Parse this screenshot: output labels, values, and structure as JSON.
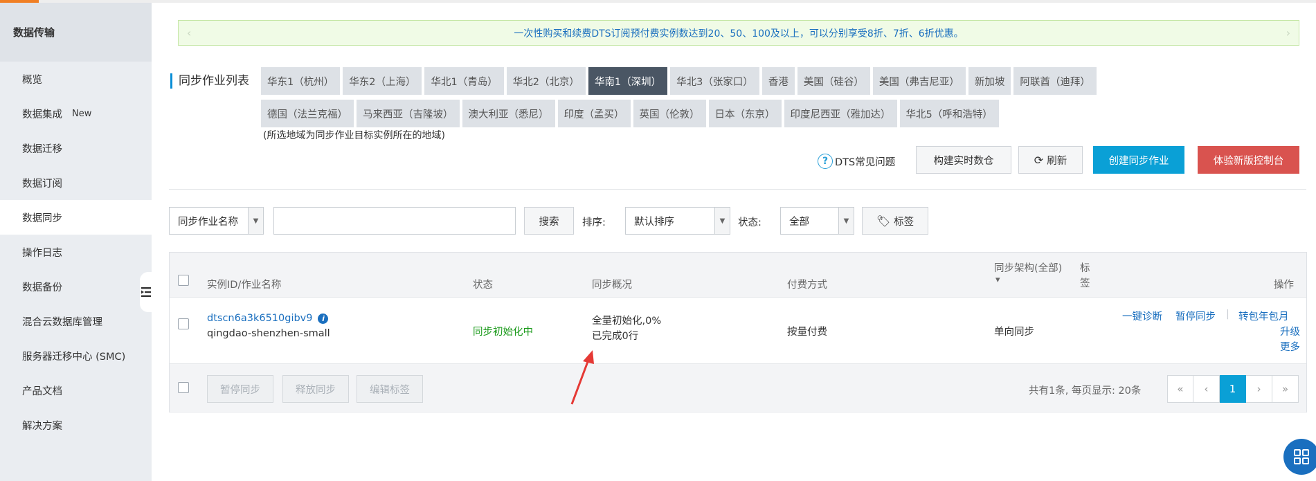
{
  "sidebar": {
    "title": "数据传输",
    "items": [
      {
        "label": "概览",
        "badge": ""
      },
      {
        "label": "数据集成",
        "badge": "New"
      },
      {
        "label": "数据迁移",
        "badge": ""
      },
      {
        "label": "数据订阅",
        "badge": ""
      },
      {
        "label": "数据同步",
        "badge": ""
      },
      {
        "label": "操作日志",
        "badge": ""
      },
      {
        "label": "数据备份",
        "badge": ""
      },
      {
        "label": "混合云数据库管理",
        "badge": ""
      },
      {
        "label": "服务器迁移中心 (SMC)",
        "badge": ""
      },
      {
        "label": "产品文档",
        "badge": ""
      },
      {
        "label": "解决方案",
        "badge": ""
      }
    ],
    "active_index": 4
  },
  "notice": {
    "text": "一次性购买和续费DTS订阅预付费实例数达到20、50、100及以上，可以分别享受8折、7折、6折优惠。",
    "prev": "‹",
    "next": "›"
  },
  "section_title": "同步作业列表",
  "regions_row1": [
    "华东1（杭州）",
    "华东2（上海）",
    "华北1（青岛）",
    "华北2（北京）",
    "华南1（深圳）",
    "华北3（张家口）",
    "香港",
    "美国（硅谷）",
    "美国（弗吉尼亚）",
    "新加坡",
    "阿联酋（迪拜）"
  ],
  "regions_row2": [
    "德国（法兰克福）",
    "马来西亚（吉隆坡）",
    "澳大利亚（悉尼）",
    "印度（孟买）",
    "英国（伦敦）",
    "日本（东京）",
    "印度尼西亚（雅加达）",
    "华北5（呼和浩特）"
  ],
  "region_active": "华南1（深圳）",
  "region_note": "(所选地域为同步作业目标实例所在的地域)",
  "toolbar": {
    "help_icon": "?",
    "help_label": "DTS常见问题",
    "build_label": "构建实时数仓",
    "refresh_icon": "⟳",
    "refresh_label": "刷新",
    "create_label": "创建同步作业",
    "new_console_label": "体验新版控制台"
  },
  "filters": {
    "name_select": "同步作业名称",
    "search_value": "",
    "search_button": "搜索",
    "sort_label": "排序:",
    "sort_value": "默认排序",
    "status_label": "状态:",
    "status_value": "全部",
    "tag_icon": "🏷",
    "tag_label": "标签"
  },
  "table": {
    "headers": {
      "id": "实例ID/作业名称",
      "status": "状态",
      "overview": "同步概况",
      "billing": "付费方式",
      "arch": "同步架构(全部)",
      "arch_sort": "▾",
      "tag_line1": "标",
      "tag_line2": "签",
      "ops": "操作"
    },
    "rows": [
      {
        "id": "dtscn6a3k6510gibv9",
        "info_icon": "i",
        "name": "qingdao-shenzhen-small",
        "status": "同步初始化中",
        "overview_line1": "全量初始化,0%",
        "overview_line2": "已完成0行",
        "billing": "按量付费",
        "arch": "单向同步",
        "actions": {
          "diagnose": "一键诊断",
          "pause": "暂停同步",
          "to_subscription": "转包年包月",
          "upgrade": "升级",
          "more": "更多"
        }
      }
    ],
    "footer": {
      "pause": "暂停同步",
      "release": "释放同步",
      "edit_tags": "编辑标签",
      "summary": "共有1条,  每页显示: 20条",
      "pager": {
        "first": "«",
        "prev": "‹",
        "current": "1",
        "next": "›",
        "last": "»"
      }
    }
  },
  "colors": {
    "accent": "#0aa0d6",
    "danger": "#d9534f",
    "status_ok": "#1b9a1b",
    "link": "#1a6fbf",
    "annotation_arrow": "#e53935"
  }
}
